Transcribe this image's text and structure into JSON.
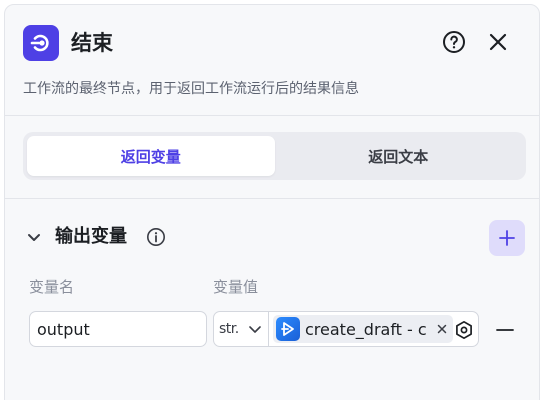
{
  "node": {
    "title": "结束",
    "description": "工作流的最终节点，用于返回工作流运行后的结果信息",
    "icon": "end-node-icon"
  },
  "header": {
    "help_icon": "question-circle-icon",
    "close_icon": "close-icon"
  },
  "mode_tabs": [
    {
      "label": "返回变量",
      "active": true
    },
    {
      "label": "返回文本",
      "active": false
    }
  ],
  "output_section": {
    "title": "输出变量",
    "info_icon": "info-icon",
    "add_icon": "plus-icon",
    "columns": {
      "name": "变量名",
      "value": "变量值"
    },
    "rows": [
      {
        "name": "output",
        "type": "str.",
        "reference": "create_draft - c",
        "reference_icon": "plugin-icon"
      }
    ]
  },
  "colors": {
    "accent": "#4e40e5",
    "panel_bg": "#f7f8fa",
    "add_button_bg": "#dfdcfb"
  }
}
